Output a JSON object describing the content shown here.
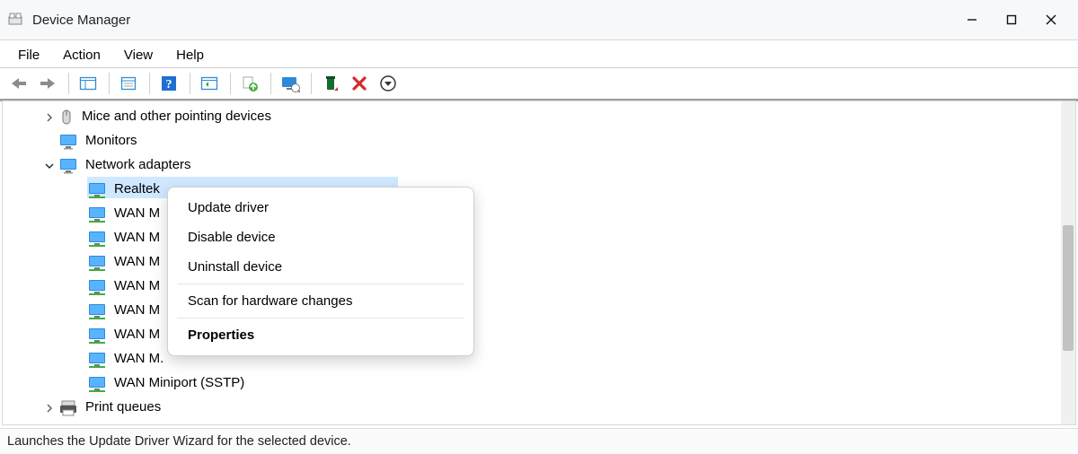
{
  "window": {
    "title": "Device Manager"
  },
  "menubar": {
    "items": [
      "File",
      "Action",
      "View",
      "Help"
    ]
  },
  "toolbar": {
    "back": "back-icon",
    "forward": "forward-icon",
    "show_hide_console": "console-tree-icon",
    "properties": "properties-icon",
    "help": "help-icon",
    "show_hidden": "show-hidden-icon",
    "update_driver": "update-driver-icon",
    "scan_hardware": "scan-hardware-icon",
    "uninstall": "uninstall-icon",
    "disable": "disable-icon",
    "action_menu": "action-menu-icon"
  },
  "tree": {
    "items": [
      {
        "label": "Mice and other pointing devices",
        "level": 0,
        "expander": "collapsed",
        "icon": "mouse",
        "selected": false
      },
      {
        "label": "Monitors",
        "level": 0,
        "expander": "none",
        "icon": "monitor",
        "selected": false
      },
      {
        "label": "Network adapters",
        "level": 0,
        "expander": "expanded",
        "icon": "monitor",
        "selected": false
      },
      {
        "label": "Realtek",
        "level": 1,
        "expander": "none",
        "icon": "net",
        "selected": true
      },
      {
        "label": "WAN M",
        "level": 1,
        "expander": "none",
        "icon": "net",
        "selected": false
      },
      {
        "label": "WAN M",
        "level": 1,
        "expander": "none",
        "icon": "net",
        "selected": false
      },
      {
        "label": "WAN M",
        "level": 1,
        "expander": "none",
        "icon": "net",
        "selected": false
      },
      {
        "label": "WAN M",
        "level": 1,
        "expander": "none",
        "icon": "net",
        "selected": false
      },
      {
        "label": "WAN M",
        "level": 1,
        "expander": "none",
        "icon": "net",
        "selected": false
      },
      {
        "label": "WAN M",
        "level": 1,
        "expander": "none",
        "icon": "net",
        "selected": false
      },
      {
        "label": "WAN M.",
        "level": 1,
        "expander": "none",
        "icon": "net",
        "selected": false
      },
      {
        "label": "WAN Miniport (SSTP)",
        "level": 1,
        "expander": "none",
        "icon": "net",
        "selected": false
      },
      {
        "label": "Print queues",
        "level": 0,
        "expander": "collapsed",
        "icon": "printer",
        "selected": false
      }
    ]
  },
  "context_menu": {
    "items": [
      {
        "label": "Update driver",
        "bold": false,
        "sep_after": false
      },
      {
        "label": "Disable device",
        "bold": false,
        "sep_after": false
      },
      {
        "label": "Uninstall device",
        "bold": false,
        "sep_after": true
      },
      {
        "label": "Scan for hardware changes",
        "bold": false,
        "sep_after": true
      },
      {
        "label": "Properties",
        "bold": true,
        "sep_after": false
      }
    ]
  },
  "statusbar": {
    "text": "Launches the Update Driver Wizard for the selected device."
  }
}
